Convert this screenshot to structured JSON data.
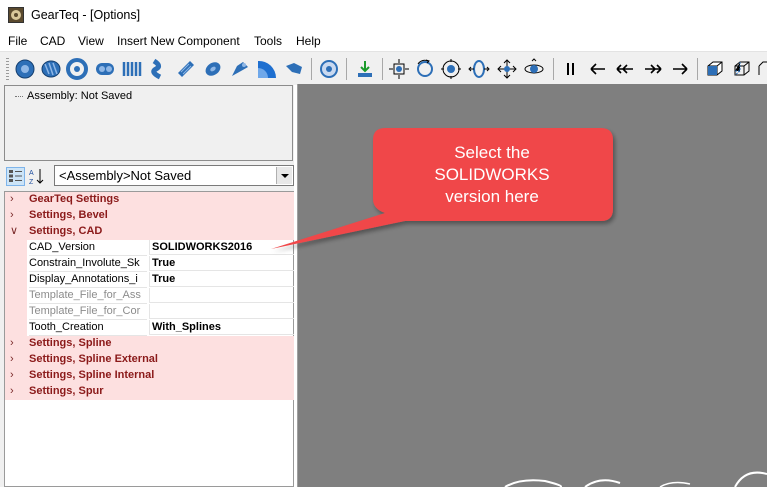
{
  "window": {
    "title": "GearTeq - [Options]"
  },
  "menu": [
    "File",
    "CAD",
    "View",
    "Insert New Component",
    "Tools",
    "Help"
  ],
  "toolbar": {
    "icons": [
      "spur-gear-icon",
      "helical-gear-icon",
      "internal-gear-icon",
      "gear-set-icon",
      "spline-icon",
      "rack-icon",
      "worm-icon",
      "worm-gear-icon",
      "bevel-gear-icon",
      "sector-gear-icon",
      "face-gear-icon",
      "hypoid-gear-icon",
      "properties-icon",
      "insert-icon",
      "zoom-fit-icon",
      "rotate-icon",
      "zoom-window-icon",
      "zoom-icon",
      "pan-icon",
      "view-rotate-icon",
      "pause-icon",
      "step-back-icon",
      "fast-back-icon",
      "fast-forward-icon",
      "step-forward-icon",
      "iso-view-icon",
      "wireframe-view-icon"
    ]
  },
  "tree": {
    "root_label": "Assembly: Not Saved"
  },
  "property_panel": {
    "combo_value": "<Assembly>Not Saved",
    "rows": [
      {
        "kind": "category",
        "expanded": false,
        "label": "GearTeq Settings"
      },
      {
        "kind": "category",
        "expanded": false,
        "label": "Settings, Bevel"
      },
      {
        "kind": "category",
        "expanded": true,
        "label": "Settings, CAD"
      },
      {
        "kind": "property",
        "name": "CAD_Version",
        "value": "SOLIDWORKS2016",
        "disabled": false
      },
      {
        "kind": "property",
        "name": "Constrain_Involute_Sk",
        "value": "True",
        "disabled": false
      },
      {
        "kind": "property",
        "name": "Display_Annotations_i",
        "value": "True",
        "disabled": false
      },
      {
        "kind": "property",
        "name": "Template_File_for_Ass",
        "value": "",
        "disabled": true
      },
      {
        "kind": "property",
        "name": "Template_File_for_Cor",
        "value": "",
        "disabled": true
      },
      {
        "kind": "property",
        "name": "Tooth_Creation",
        "value": "With_Splines",
        "disabled": false
      },
      {
        "kind": "category",
        "expanded": false,
        "label": "Settings, Spline"
      },
      {
        "kind": "category",
        "expanded": false,
        "label": "Settings, Spline External"
      },
      {
        "kind": "category",
        "expanded": false,
        "label": "Settings, Spline Internal"
      },
      {
        "kind": "category",
        "expanded": false,
        "label": "Settings, Spur"
      }
    ]
  },
  "callout": {
    "lines": [
      "Select the",
      "SOLIDWORKS",
      "version here"
    ],
    "color": "#f0474a"
  },
  "colors": {
    "category_bg": "#fde0e0",
    "category_text": "#8b1a1a",
    "viewport_bg": "#7f7f7f",
    "toolbar_blue": "#2d6fb7"
  }
}
